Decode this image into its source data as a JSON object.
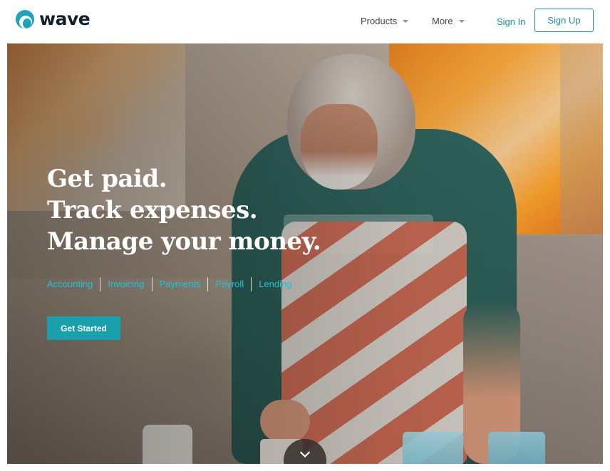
{
  "brand": {
    "name": "wave",
    "accent": "#1d8fa6",
    "cta_color": "#1aa0ad"
  },
  "nav": {
    "products_label": "Products",
    "more_label": "More",
    "signin_label": "Sign In",
    "signup_label": "Sign Up"
  },
  "hero": {
    "headline": [
      "Get paid.",
      "Track expenses.",
      "Manage your money."
    ],
    "services": [
      "Accounting",
      "Invoicing",
      "Payments",
      "Payroll",
      "Lending"
    ],
    "cta_label": "Get Started",
    "scroll_icon": "chevron-down-icon"
  }
}
